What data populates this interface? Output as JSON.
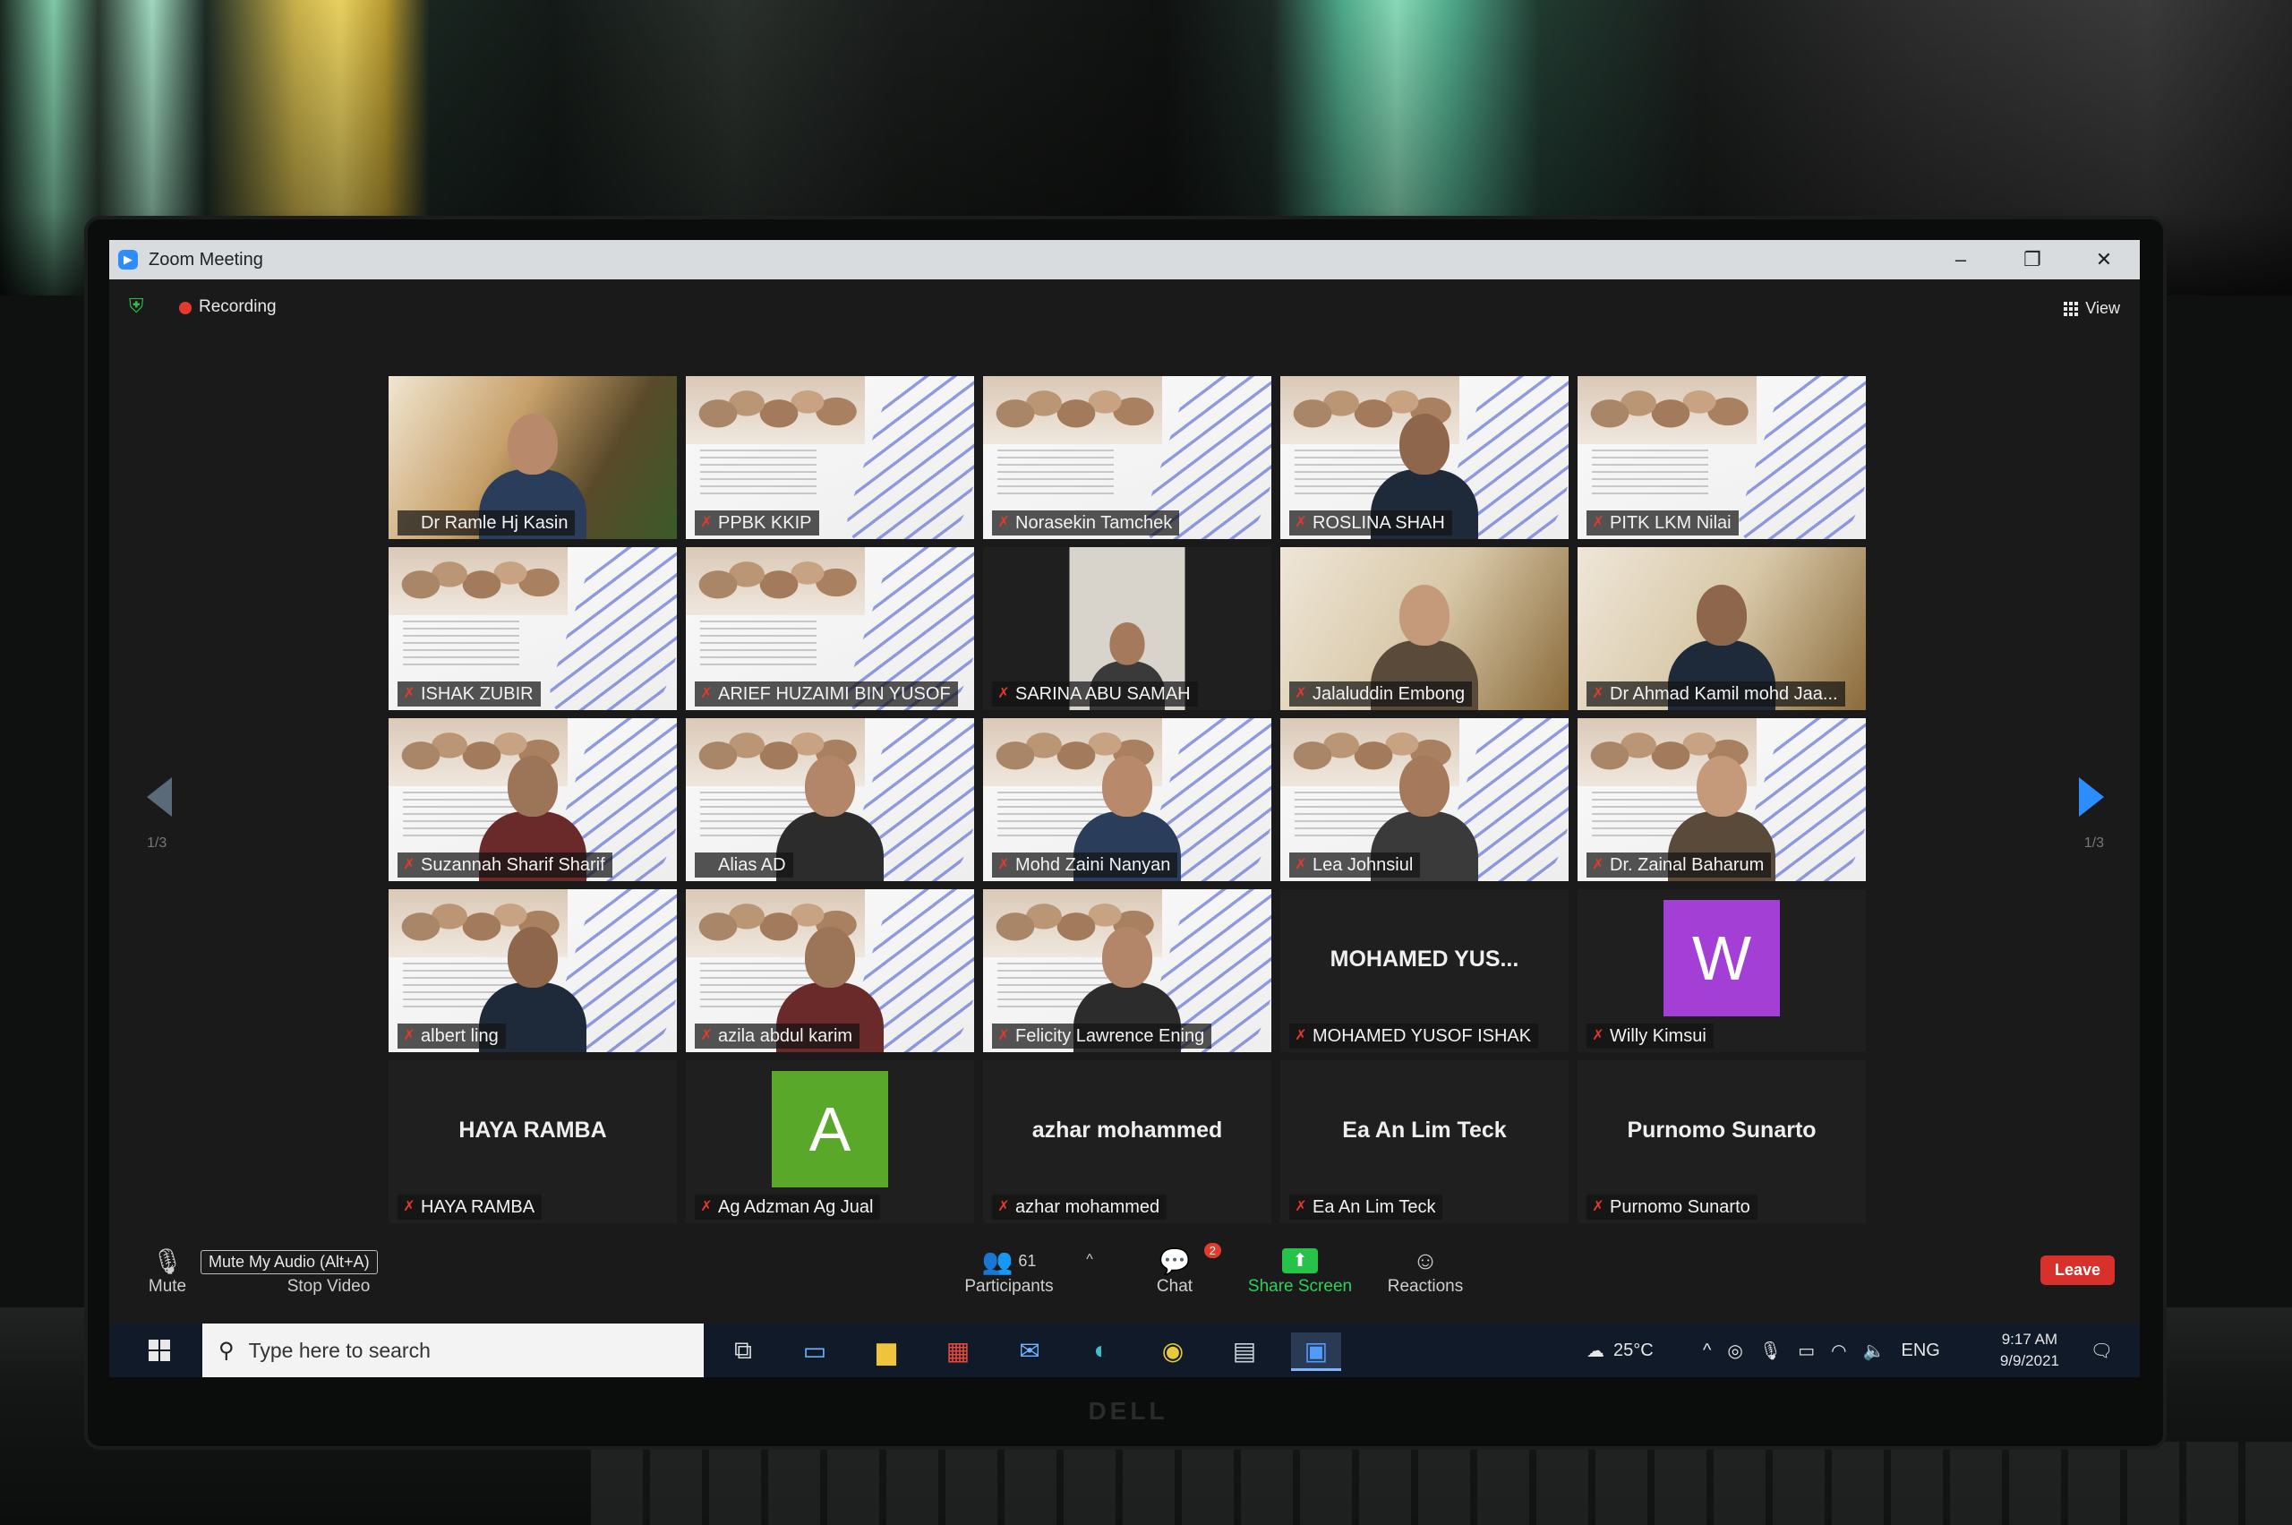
{
  "window": {
    "title": "Zoom Meeting",
    "minimize_icon": "minimize-icon",
    "restore_icon": "restore-icon",
    "close_icon": "close-icon"
  },
  "topbar": {
    "security_icon": "shield-check-icon",
    "recording_label": "Recording",
    "view_label": "View"
  },
  "gallery": {
    "page_indicator_left": "1/3",
    "page_indicator_right": "1/3",
    "tiles": [
      {
        "name": "Dr Ramle Hj Kasin",
        "type": "webcam",
        "active": true,
        "muted": false
      },
      {
        "name": "PPBK KKIP",
        "type": "slide",
        "muted": true
      },
      {
        "name": "Norasekin Tamchek",
        "type": "slide",
        "muted": true
      },
      {
        "name": "ROSLINA SHAH",
        "type": "slide-person",
        "muted": true
      },
      {
        "name": "PITK LKM Nilai",
        "type": "slide",
        "muted": true
      },
      {
        "name": "ISHAK ZUBIR",
        "type": "slide",
        "muted": true
      },
      {
        "name": "ARIEF HUZAIMI BIN YUSOF",
        "type": "slide",
        "muted": true
      },
      {
        "name": "SARINA ABU SAMAH",
        "type": "webcam-small",
        "muted": true
      },
      {
        "name": "Jalaluddin Embong",
        "type": "webcam",
        "muted": true
      },
      {
        "name": "Dr Ahmad Kamil mohd Jaa...",
        "type": "webcam",
        "muted": true
      },
      {
        "name": "Suzannah Sharif Sharif",
        "type": "slide-person",
        "muted": true
      },
      {
        "name": "Alias AD",
        "type": "slide-person",
        "muted": false
      },
      {
        "name": "Mohd Zaini Nanyan",
        "type": "slide-person",
        "muted": true
      },
      {
        "name": "Lea Johnsiul",
        "type": "slide-person",
        "muted": true
      },
      {
        "name": "Dr. Zainal Baharum",
        "type": "slide-person",
        "muted": true
      },
      {
        "name": "albert ling",
        "type": "slide-person",
        "muted": true
      },
      {
        "name": "azila abdul karim",
        "type": "slide-person",
        "muted": true
      },
      {
        "name": "Felicity Lawrence Ening",
        "type": "slide-person",
        "muted": true
      },
      {
        "name": "MOHAMED YUSOF ISHAK",
        "type": "name-only",
        "display": "MOHAMED  YUS...",
        "muted": true
      },
      {
        "name": "Willy Kimsui",
        "type": "avatar",
        "letter": "W",
        "color": "#a43fd6",
        "muted": true
      },
      {
        "name": "HAYA RAMBA",
        "type": "name-only",
        "display": "HAYA RAMBA",
        "muted": true
      },
      {
        "name": "Ag Adzman Ag Jual",
        "type": "avatar",
        "letter": "A",
        "color": "#5aa82a",
        "muted": true
      },
      {
        "name": "azhar mohammed",
        "type": "name-only",
        "display": "azhar mohammed",
        "muted": true
      },
      {
        "name": "Ea An Lim Teck",
        "type": "name-only",
        "display": "Ea An Lim Teck",
        "muted": true
      },
      {
        "name": "Purnomo Sunarto",
        "type": "name-only",
        "display": "Purnomo Sunarto",
        "muted": true
      }
    ]
  },
  "toolbar": {
    "mute_label": "Mute",
    "mute_tooltip": "Mute My Audio (Alt+A)",
    "stop_video_label": "Stop Video",
    "participants_label": "Participants",
    "participants_count": "61",
    "chat_label": "Chat",
    "chat_badge": "2",
    "share_label": "Share Screen",
    "reactions_label": "Reactions",
    "leave_label": "Leave"
  },
  "taskbar": {
    "search_placeholder": "Type here to search",
    "weather": "25°C",
    "language": "ENG",
    "time": "9:17 AM",
    "date": "9/9/2021"
  },
  "colors": {
    "zoom_blue": "#2d8cff",
    "active_speaker": "#e8e14a",
    "muted_red": "#e5392c",
    "leave_red": "#d8302a",
    "share_green": "#26c24a"
  }
}
